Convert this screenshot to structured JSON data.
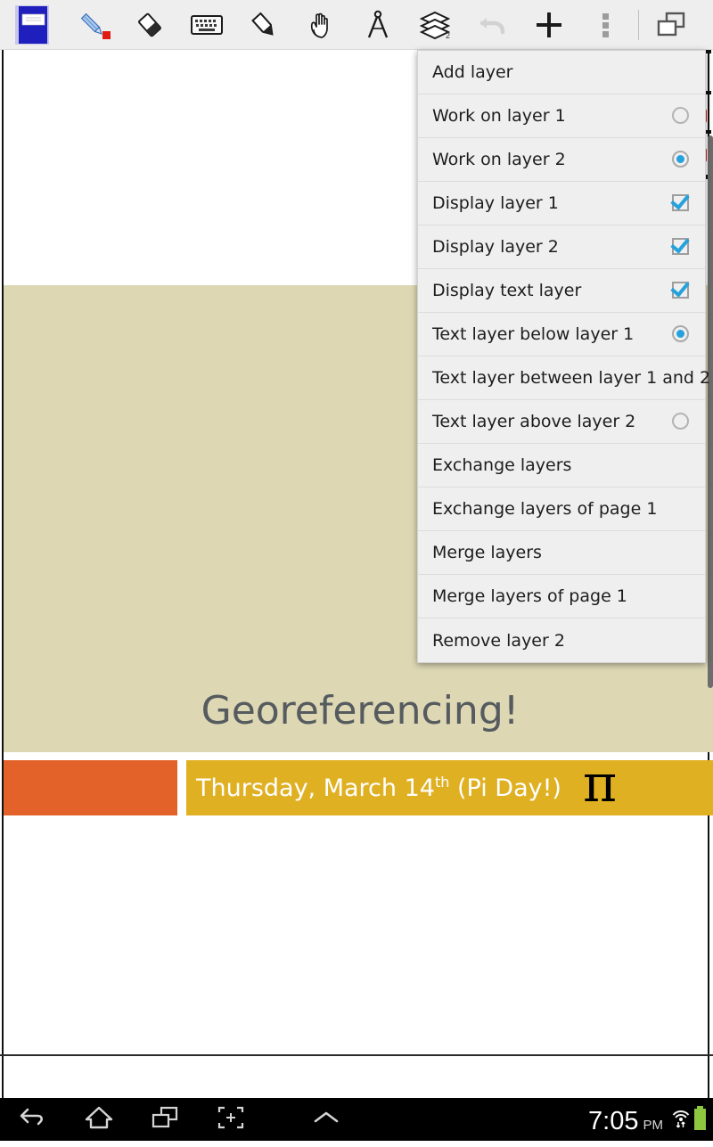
{
  "toolbar": {
    "tools": [
      {
        "name": "notebook-icon",
        "label": "Notebook"
      },
      {
        "name": "pen-icon",
        "label": "Pen"
      },
      {
        "name": "eraser-icon",
        "label": "Eraser"
      },
      {
        "name": "keyboard-icon",
        "label": "Keyboard"
      },
      {
        "name": "highlighter-icon",
        "label": "Highlighter"
      },
      {
        "name": "hand-icon",
        "label": "Hand"
      },
      {
        "name": "compass-icon",
        "label": "Compass"
      },
      {
        "name": "layers-icon",
        "label": "Layers"
      },
      {
        "name": "undo-icon",
        "label": "Undo"
      },
      {
        "name": "add-icon",
        "label": "Add"
      },
      {
        "name": "overflow-icon",
        "label": "More options"
      },
      {
        "name": "window-icon",
        "label": "Multi window"
      }
    ],
    "layers_badge": "2"
  },
  "layer_menu": {
    "items": [
      {
        "label": "Add layer",
        "control": "none",
        "checked": false
      },
      {
        "label": "Work on layer 1",
        "control": "radio",
        "checked": false
      },
      {
        "label": "Work on layer 2",
        "control": "radio",
        "checked": true
      },
      {
        "label": "Display layer 1",
        "control": "checkbox",
        "checked": true
      },
      {
        "label": "Display layer 2",
        "control": "checkbox",
        "checked": true
      },
      {
        "label": "Display text layer",
        "control": "checkbox",
        "checked": true
      },
      {
        "label": "Text layer below layer 1",
        "control": "radio",
        "checked": true
      },
      {
        "label": "Text layer between layer 1 and 2",
        "control": "radio",
        "checked": false
      },
      {
        "label": "Text layer above layer 2",
        "control": "radio",
        "checked": false
      },
      {
        "label": "Exchange layers",
        "control": "none",
        "checked": false
      },
      {
        "label": "Exchange layers of page 1",
        "control": "none",
        "checked": false
      },
      {
        "label": "Merge layers",
        "control": "none",
        "checked": false
      },
      {
        "label": "Merge layers of page 1",
        "control": "none",
        "checked": false
      },
      {
        "label": "Remove layer 2",
        "control": "none",
        "checked": false
      }
    ]
  },
  "document": {
    "title": "Georeferencing!",
    "date_prefix": "Thursday, March 14",
    "date_suffix_sup": "th",
    "date_tail": " (Pi Day!)",
    "pi_symbol": "π"
  },
  "navbar": {
    "buttons": [
      {
        "name": "back-icon",
        "label": "Back"
      },
      {
        "name": "home-icon",
        "label": "Home"
      },
      {
        "name": "recents-icon",
        "label": "Recent apps"
      },
      {
        "name": "screenshot-icon",
        "label": "Screen capture"
      },
      {
        "name": "expand-icon",
        "label": "Expand"
      }
    ],
    "clock": "7:05",
    "ampm": "PM",
    "wifi_label": "Wi-Fi",
    "battery_label": "Battery"
  },
  "colors": {
    "toolbar_bg": "#eeeeee",
    "menu_bg": "#efefef",
    "accent": "#25a2dc",
    "beige": "#ddd7b4",
    "orange": "#e2622a",
    "gold": "#e0b023",
    "title_text": "#555b5e",
    "pen_dot": "#e01b12",
    "battery_green": "#8ec63f"
  }
}
